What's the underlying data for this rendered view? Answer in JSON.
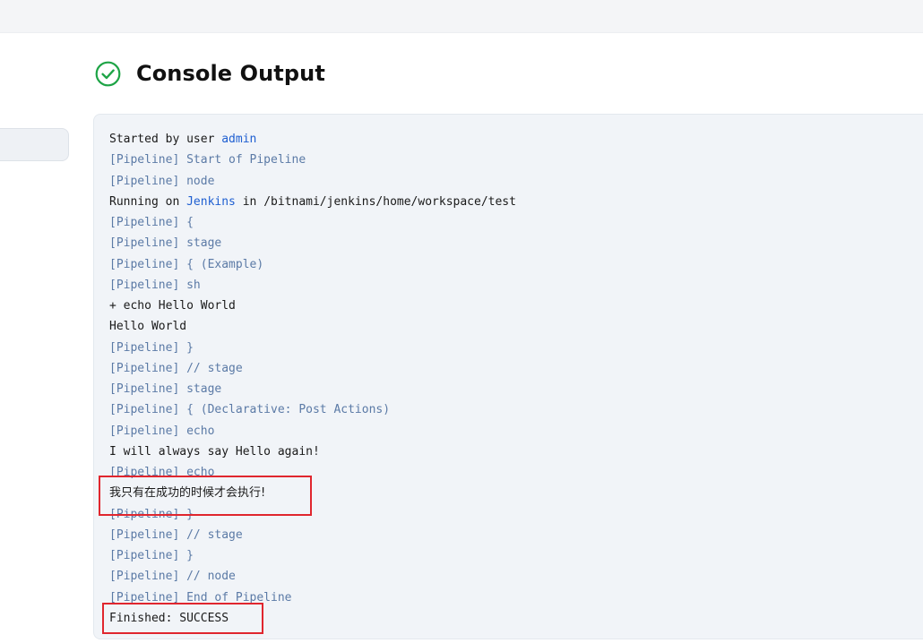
{
  "header": {
    "title": "Console Output",
    "status_icon": "check-circle-icon",
    "status_color": "#1ea446"
  },
  "console": {
    "lines": [
      {
        "type": "text",
        "segments": [
          {
            "text": "Started by user "
          },
          {
            "text": "admin",
            "link": true
          }
        ]
      },
      {
        "type": "pipeline",
        "segments": [
          {
            "text": "[Pipeline] Start of Pipeline"
          }
        ]
      },
      {
        "type": "pipeline",
        "segments": [
          {
            "text": "[Pipeline] node"
          }
        ]
      },
      {
        "type": "text",
        "segments": [
          {
            "text": "Running on "
          },
          {
            "text": "Jenkins",
            "link": true
          },
          {
            "text": " in /bitnami/jenkins/home/workspace/test"
          }
        ]
      },
      {
        "type": "pipeline",
        "segments": [
          {
            "text": "[Pipeline] {"
          }
        ]
      },
      {
        "type": "pipeline",
        "segments": [
          {
            "text": "[Pipeline] stage"
          }
        ]
      },
      {
        "type": "pipeline",
        "segments": [
          {
            "text": "[Pipeline] { (Example)"
          }
        ]
      },
      {
        "type": "pipeline",
        "segments": [
          {
            "text": "[Pipeline] sh"
          }
        ]
      },
      {
        "type": "text",
        "segments": [
          {
            "text": "+ echo Hello World"
          }
        ]
      },
      {
        "type": "text",
        "segments": [
          {
            "text": "Hello World"
          }
        ]
      },
      {
        "type": "pipeline",
        "segments": [
          {
            "text": "[Pipeline] }"
          }
        ]
      },
      {
        "type": "pipeline",
        "segments": [
          {
            "text": "[Pipeline] // stage"
          }
        ]
      },
      {
        "type": "pipeline",
        "segments": [
          {
            "text": "[Pipeline] stage"
          }
        ]
      },
      {
        "type": "pipeline",
        "segments": [
          {
            "text": "[Pipeline] { (Declarative: Post Actions)"
          }
        ]
      },
      {
        "type": "pipeline",
        "segments": [
          {
            "text": "[Pipeline] echo"
          }
        ]
      },
      {
        "type": "text",
        "segments": [
          {
            "text": "I will always say Hello again!"
          }
        ]
      },
      {
        "type": "pipeline",
        "segments": [
          {
            "text": "[Pipeline] echo"
          }
        ]
      },
      {
        "type": "text",
        "highlight": true,
        "segments": [
          {
            "text": "我只有在成功的时候才会执行!",
            "cjk": true
          }
        ]
      },
      {
        "type": "pipeline",
        "segments": [
          {
            "text": "[Pipeline] }"
          }
        ]
      },
      {
        "type": "pipeline",
        "segments": [
          {
            "text": "[Pipeline] // stage"
          }
        ]
      },
      {
        "type": "pipeline",
        "segments": [
          {
            "text": "[Pipeline] }"
          }
        ]
      },
      {
        "type": "pipeline",
        "segments": [
          {
            "text": "[Pipeline] // node"
          }
        ]
      },
      {
        "type": "pipeline",
        "segments": [
          {
            "text": "[Pipeline] End of Pipeline"
          }
        ]
      },
      {
        "type": "text",
        "highlight": true,
        "segments": [
          {
            "text": "Finished: SUCCESS"
          }
        ]
      }
    ]
  },
  "colors": {
    "pipeline_text": "#5b7aa6",
    "link_text": "#1f5fd1",
    "highlight_box": "#e0262e"
  }
}
